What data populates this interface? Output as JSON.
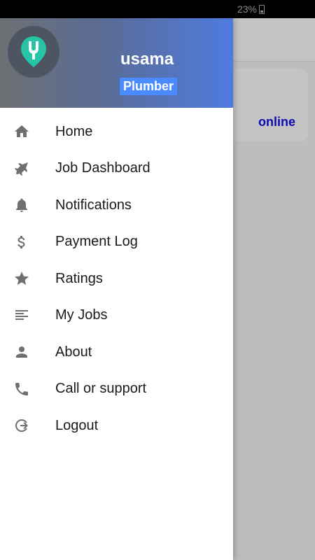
{
  "status_bar": {
    "battery": "23%"
  },
  "background": {
    "status_text": "online",
    "status_color": "#0a0ab0"
  },
  "header": {
    "user_name": "usama",
    "role": "Plumber",
    "colors": {
      "gradient_start": "#6d6f73",
      "gradient_end": "#4f7be0",
      "badge": "#4a8cff"
    }
  },
  "menu": {
    "items": [
      {
        "label": "Home",
        "icon": "home-icon"
      },
      {
        "label": "Job Dashboard",
        "icon": "jet-icon"
      },
      {
        "label": "Notifications",
        "icon": "bell-icon"
      },
      {
        "label": "Payment Log",
        "icon": "dollar-icon"
      },
      {
        "label": "Ratings",
        "icon": "star-icon"
      },
      {
        "label": "My Jobs",
        "icon": "list-icon"
      },
      {
        "label": "About",
        "icon": "person-icon"
      },
      {
        "label": "Call or support",
        "icon": "phone-icon"
      },
      {
        "label": "Logout",
        "icon": "logout-icon"
      }
    ]
  }
}
